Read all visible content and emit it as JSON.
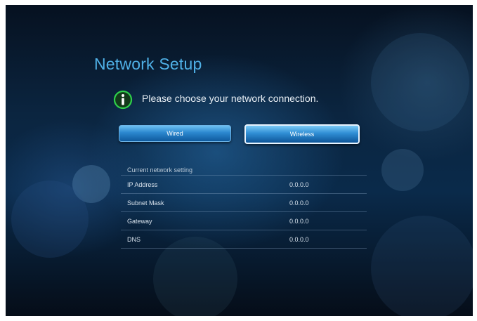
{
  "page": {
    "title": "Network Setup",
    "prompt": "Please choose your network connection.",
    "info_icon": "info-circle-icon",
    "accent_color": "#4fb0e6",
    "icon_color": "#29c03a"
  },
  "buttons": {
    "wired_label": "Wired",
    "wireless_label": "Wireless",
    "selected": "Wireless"
  },
  "settings": {
    "header": "Current network setting",
    "rows": [
      {
        "label": "IP Address",
        "value": "0.0.0.0"
      },
      {
        "label": "Subnet Mask",
        "value": "0.0.0.0"
      },
      {
        "label": "Gateway",
        "value": "0.0.0.0"
      },
      {
        "label": "DNS",
        "value": "0.0.0.0"
      }
    ]
  }
}
